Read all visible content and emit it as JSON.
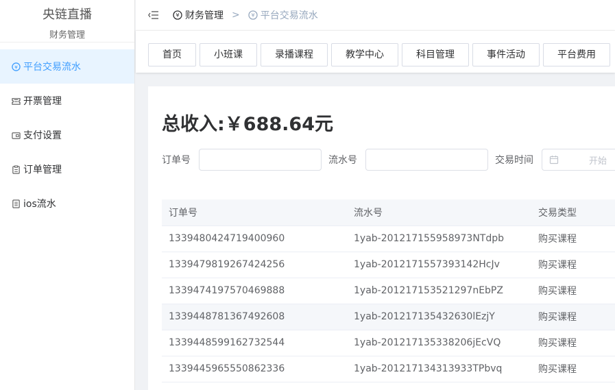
{
  "brand": {
    "title": "央链直播",
    "subtitle": "财务管理"
  },
  "sidebar": {
    "items": [
      {
        "label": "平台交易流水",
        "icon": "transaction-icon",
        "active": true
      },
      {
        "label": "开票管理",
        "icon": "ticket-icon",
        "active": false
      },
      {
        "label": "支付设置",
        "icon": "wallet-icon",
        "active": false
      },
      {
        "label": "订单管理",
        "icon": "clipboard-icon",
        "active": false
      },
      {
        "label": "ios流水",
        "icon": "document-icon",
        "active": false
      }
    ]
  },
  "breadcrumb": {
    "first": "财务管理",
    "separator": ">",
    "second": "平台交易流水"
  },
  "tags": [
    "首页",
    "小班课",
    "录播课程",
    "教学中心",
    "科目管理",
    "事件活动",
    "平台费用"
  ],
  "summary": {
    "total": "总收入:￥688.64元"
  },
  "filters": {
    "order_label": "订单号",
    "serial_label": "流水号",
    "time_label": "交易时间",
    "date_start_placeholder": "开始"
  },
  "table": {
    "headers": [
      "订单号",
      "流水号",
      "交易类型"
    ],
    "rows": [
      [
        "1339480424719400960",
        "1yab-20121715595897 3NTdpb",
        "购买课程"
      ],
      [
        "1339479819267424256",
        "1yab-201217155739314 2HcJv",
        "购买课程"
      ],
      [
        "1339474197570469888",
        "1yab-201217153521297nEbPZ",
        "购买课程"
      ],
      [
        "1339448781367492608",
        "1yab-201217135432630lEzjY",
        "购买课程"
      ],
      [
        "1339448599162732544",
        "1yab-201217135338206jEcVQ",
        "购买课程"
      ],
      [
        "1339445965550862336",
        "1yab-201217134313933TPbvq",
        "购买课程"
      ]
    ]
  }
}
